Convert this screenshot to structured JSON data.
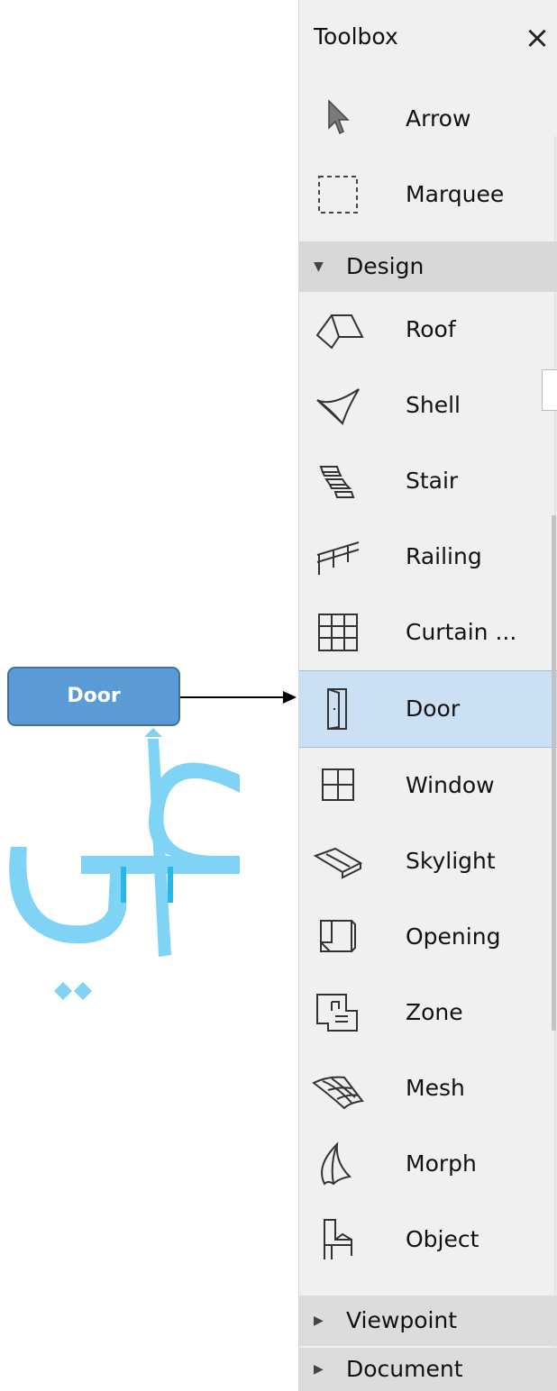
{
  "toolbox": {
    "title": "Toolbox",
    "close_glyph": "×",
    "top_tools": [
      {
        "label": "Arrow",
        "icon": "arrow-pointer-icon"
      },
      {
        "label": "Marquee",
        "icon": "marquee-icon"
      }
    ],
    "groups": [
      {
        "label": "Design",
        "state": "expanded"
      },
      {
        "label": "Viewpoint",
        "state": "collapsed"
      },
      {
        "label": "Document",
        "state": "collapsed"
      }
    ],
    "design_tools": [
      {
        "label": "Roof",
        "icon": "roof-icon"
      },
      {
        "label": "Shell",
        "icon": "shell-icon"
      },
      {
        "label": "Stair",
        "icon": "stair-icon"
      },
      {
        "label": "Railing",
        "icon": "railing-icon"
      },
      {
        "label": "Curtain ...",
        "icon": "curtain-wall-icon"
      },
      {
        "label": "Door",
        "icon": "door-icon",
        "selected": true
      },
      {
        "label": "Window",
        "icon": "window-icon"
      },
      {
        "label": "Skylight",
        "icon": "skylight-icon"
      },
      {
        "label": "Opening",
        "icon": "opening-icon"
      },
      {
        "label": "Zone",
        "icon": "zone-icon"
      },
      {
        "label": "Mesh",
        "icon": "mesh-icon"
      },
      {
        "label": "Morph",
        "icon": "morph-icon"
      },
      {
        "label": "Object",
        "icon": "object-chair-icon"
      }
    ]
  },
  "annotation": {
    "callout_label": "Door",
    "watermark_text": "علي",
    "colors": {
      "callout_fill": "#5b9bd5",
      "callout_border": "#41719c",
      "watermark": "#7fd4f5"
    }
  },
  "colors": {
    "panel_bg": "#f0f0f0",
    "group_header_bg": "#d8d8d8",
    "selected_bg": "#cce0f4"
  }
}
